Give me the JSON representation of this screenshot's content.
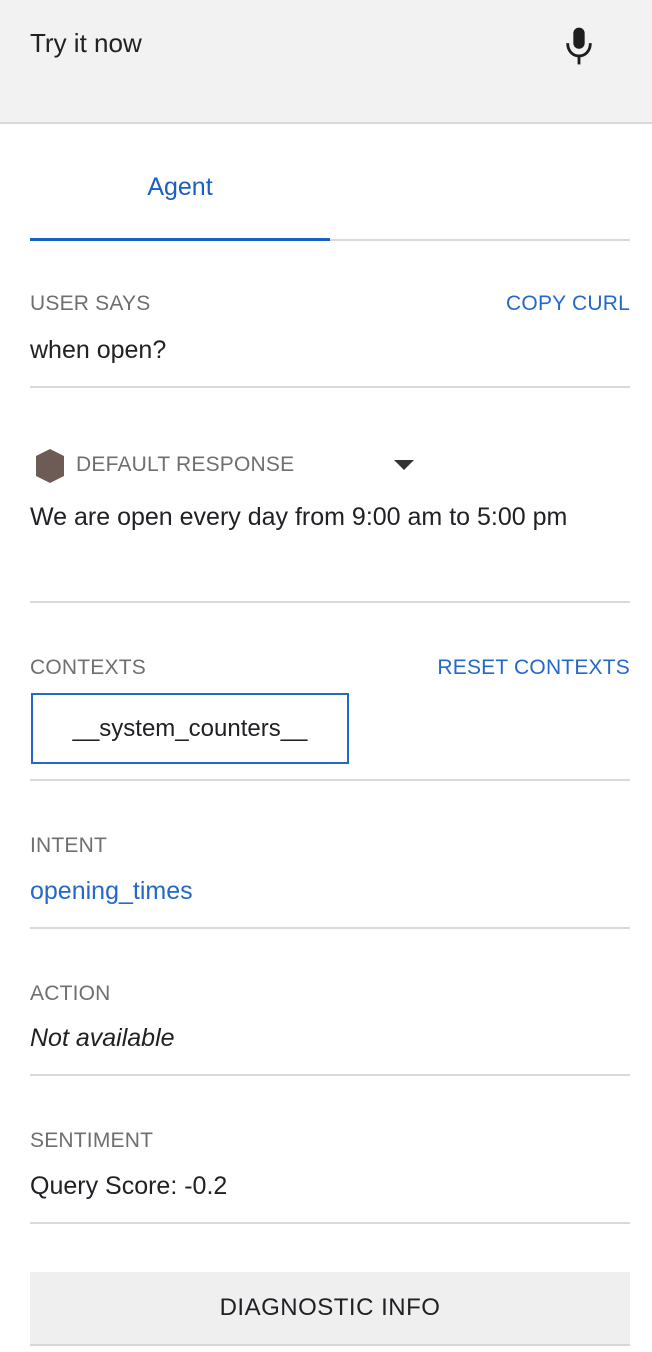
{
  "input": {
    "placeholder": "Try it now"
  },
  "tabs": [
    {
      "label": "Agent"
    }
  ],
  "user_says": {
    "label": "USER SAYS",
    "action_link": "COPY CURL",
    "value": "when open?"
  },
  "response": {
    "label": "DEFAULT RESPONSE",
    "value": "We are open every day from 9:00 am to 5:00 pm"
  },
  "contexts": {
    "label": "CONTEXTS",
    "action_link": "RESET CONTEXTS",
    "chips": [
      "__system_counters__"
    ]
  },
  "intent": {
    "label": "INTENT",
    "value": "opening_times"
  },
  "action": {
    "label": "ACTION",
    "value": "Not available"
  },
  "sentiment": {
    "label": "SENTIMENT",
    "value": "Query Score: -0.2"
  },
  "diagnostic": {
    "label": "DIAGNOSTIC INFO"
  },
  "colors": {
    "accent": "#1a5fc4",
    "link": "#2468c9",
    "bot_icon": "#6d5b56"
  },
  "icons": {
    "mic": "microphone-icon",
    "bot": "bot-avatar-icon",
    "dropdown": "caret-down-icon"
  }
}
